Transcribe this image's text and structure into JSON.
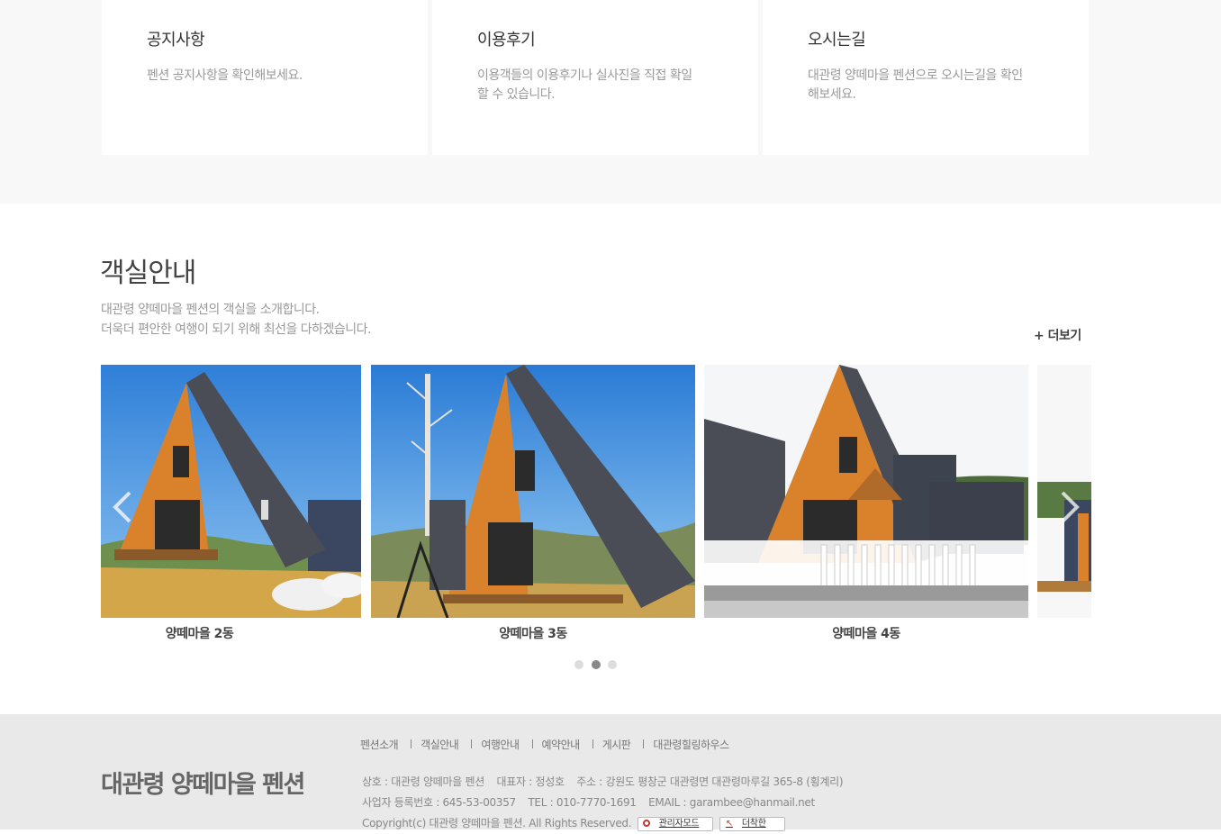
{
  "info_cards": [
    {
      "title": "공지사항",
      "desc": "펜션 공지사항을 확인해보세요."
    },
    {
      "title": "이용후기",
      "desc": "이용객들의 이용후기나 실사진을 직접 확일할 수 있습니다."
    },
    {
      "title": "오시는길",
      "desc": "대관령 양떼마을 펜션으로 오시는길을 확인해보세요."
    }
  ],
  "rooms": {
    "title": "객실안내",
    "desc_line1": "대관령 양떼마을 펜션의 객실을 소개합니다.",
    "desc_line2": "더욱더 편안한 여행이 되기 위해 최선을 다하겠습니다.",
    "more_label": "+ 더보기",
    "slides": [
      {
        "caption": "양떼마을 2동"
      },
      {
        "caption": "양떼마을 3동"
      },
      {
        "caption": "양떼마을 4동"
      }
    ],
    "prev_icon": "chevron-left-icon",
    "next_icon": "chevron-right-icon",
    "pagination": {
      "total": 3,
      "active": 2
    }
  },
  "footer": {
    "logo": "대관령 양떼마을 펜션",
    "nav": [
      "펜션소개",
      "객실안내",
      "여행안내",
      "예약안내",
      "게시판",
      "대관령힐링하우스"
    ],
    "business_name": "상호 : 대관령 양떼마을 펜션",
    "ceo": "대표자 : 정성호",
    "address": "주소 : 강원도 평창군 대관령면 대관령마루길 365-8 (횡계리)",
    "reg_no": "사업자 등록번호 : 645-53-00357",
    "tel": "TEL : 010-7770-1691",
    "email": "EMAIL : garambee@hanmail.net",
    "copyright": "Copyright(c) 대관령 양떼마을 펜션. All Rights Reserved.",
    "admin_label": "관리자모드",
    "maker_label": "더착한"
  },
  "colors": {
    "background_band": "#f8f8f8",
    "footer_bg": "#e9e9e9",
    "roof": "#4a4d55",
    "wood": "#d9822b"
  }
}
